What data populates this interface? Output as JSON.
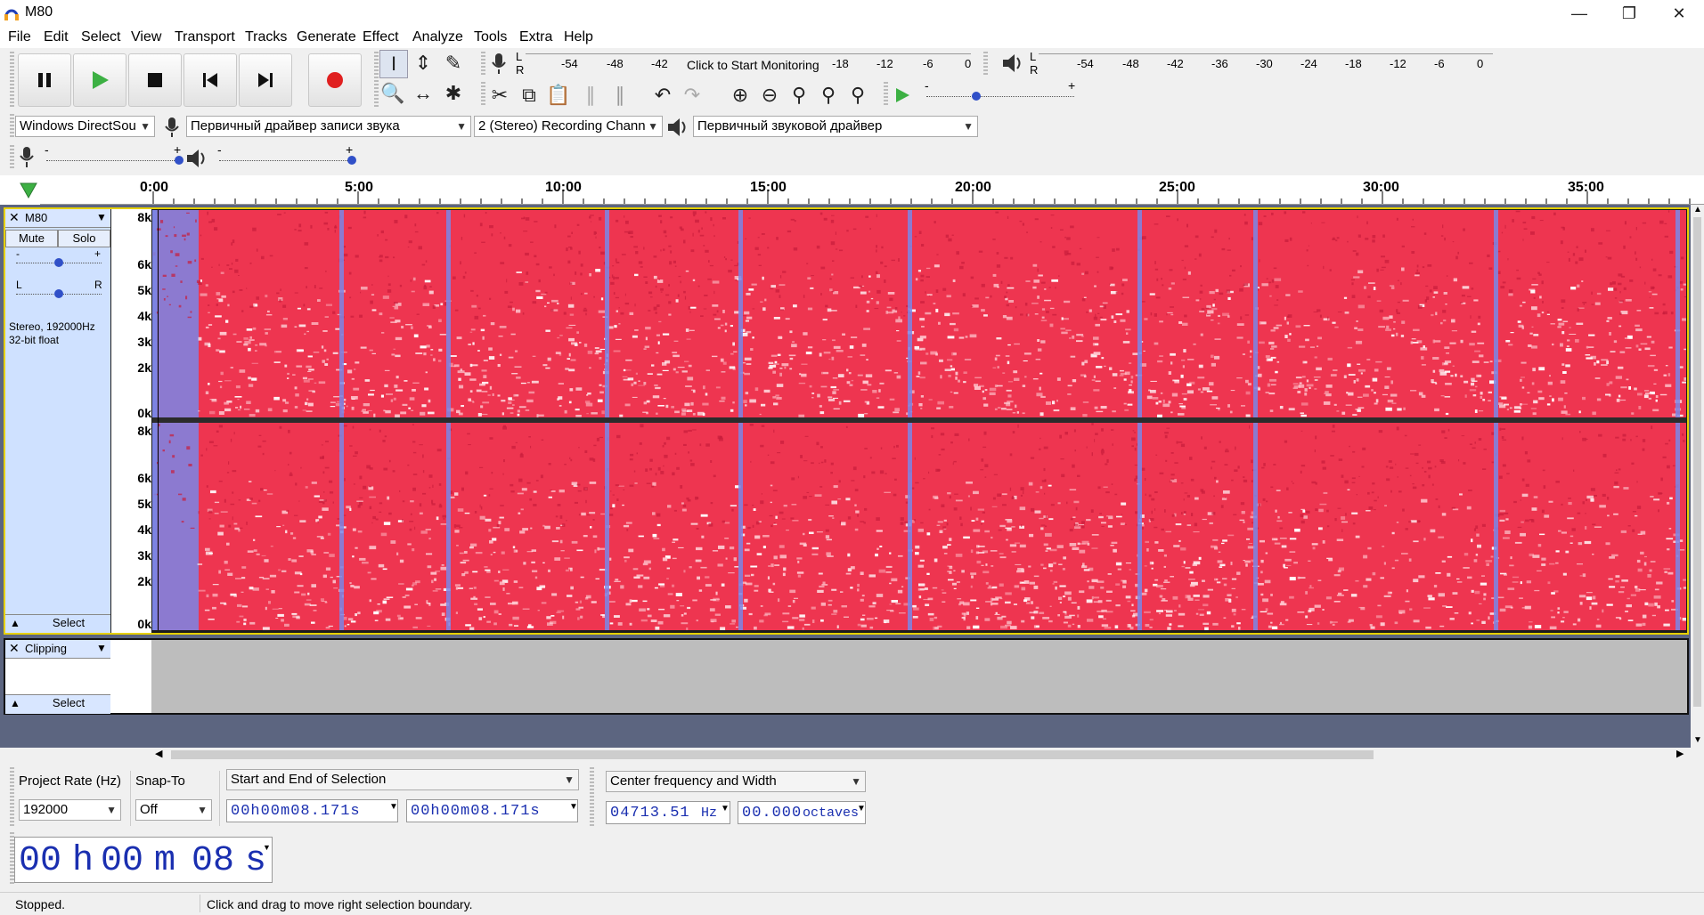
{
  "window": {
    "title": "M80"
  },
  "menu": [
    "File",
    "Edit",
    "Select",
    "View",
    "Transport",
    "Tracks",
    "Generate",
    "Effect",
    "Analyze",
    "Tools",
    "Extra",
    "Help"
  ],
  "transport": {
    "buttons": [
      "pause",
      "play",
      "stop",
      "skip-start",
      "skip-end",
      "record"
    ]
  },
  "record_meter": {
    "lr": [
      "L",
      "R"
    ],
    "scale": [
      "-54",
      "-48",
      "-42",
      "-18",
      "-12",
      "-6",
      "0"
    ],
    "prompt": "Click to Start Monitoring"
  },
  "play_meter": {
    "lr": [
      "L",
      "R"
    ],
    "scale": [
      "-54",
      "-48",
      "-42",
      "-36",
      "-30",
      "-24",
      "-18",
      "-12",
      "-6",
      "0"
    ]
  },
  "play_at_speed": {
    "minus": "-",
    "plus": "+"
  },
  "device": {
    "host": "Windows DirectSou",
    "recording_device": "Первичный драйвер записи звука",
    "channels": "2 (Stereo) Recording Chann",
    "playback_device": "Первичный звуковой драйвер"
  },
  "mixer": {
    "minus": "-",
    "plus": "+"
  },
  "ruler": {
    "labels": [
      "0:00",
      "5:00",
      "10:00",
      "15:00",
      "20:00",
      "25:00",
      "30:00",
      "35:00"
    ]
  },
  "audio_track": {
    "name": "M80",
    "mute": "Mute",
    "solo": "Solo",
    "gain_minus": "-",
    "gain_plus": "+",
    "pan_l": "L",
    "pan_r": "R",
    "info_line1": "Stereo, 192000Hz",
    "info_line2": "32-bit float",
    "select": "Select",
    "freq_labels": [
      "8k",
      "6k",
      "5k",
      "4k",
      "3k",
      "2k",
      "0k"
    ]
  },
  "label_track": {
    "name": "Clipping",
    "select": "Select"
  },
  "selection_bar": {
    "project_rate_label": "Project Rate (Hz)",
    "project_rate": "192000",
    "snap_to_label": "Snap-To",
    "snap_to": "Off",
    "selection_mode": "Start and End of Selection",
    "start_time": "00h00m08.171s",
    "end_time": "00h00m08.171s"
  },
  "spectral_selection": {
    "mode": "Center frequency and Width",
    "center": "04713.51",
    "center_unit": "Hz",
    "width": "00.000",
    "width_unit": "octaves"
  },
  "time_toolbar": {
    "h": "00",
    "h_unit": "h",
    "m": "00",
    "m_unit": "m",
    "s": "08",
    "s_unit": "s"
  },
  "status": {
    "state": "Stopped.",
    "hint": "Click and drag to move right selection boundary."
  },
  "colors": {
    "spectrogram_base": "#ee3550",
    "spectrogram_cool": "#7a86e6",
    "track_panel": "#cfe1ff",
    "digits": "#1a2fb0"
  }
}
